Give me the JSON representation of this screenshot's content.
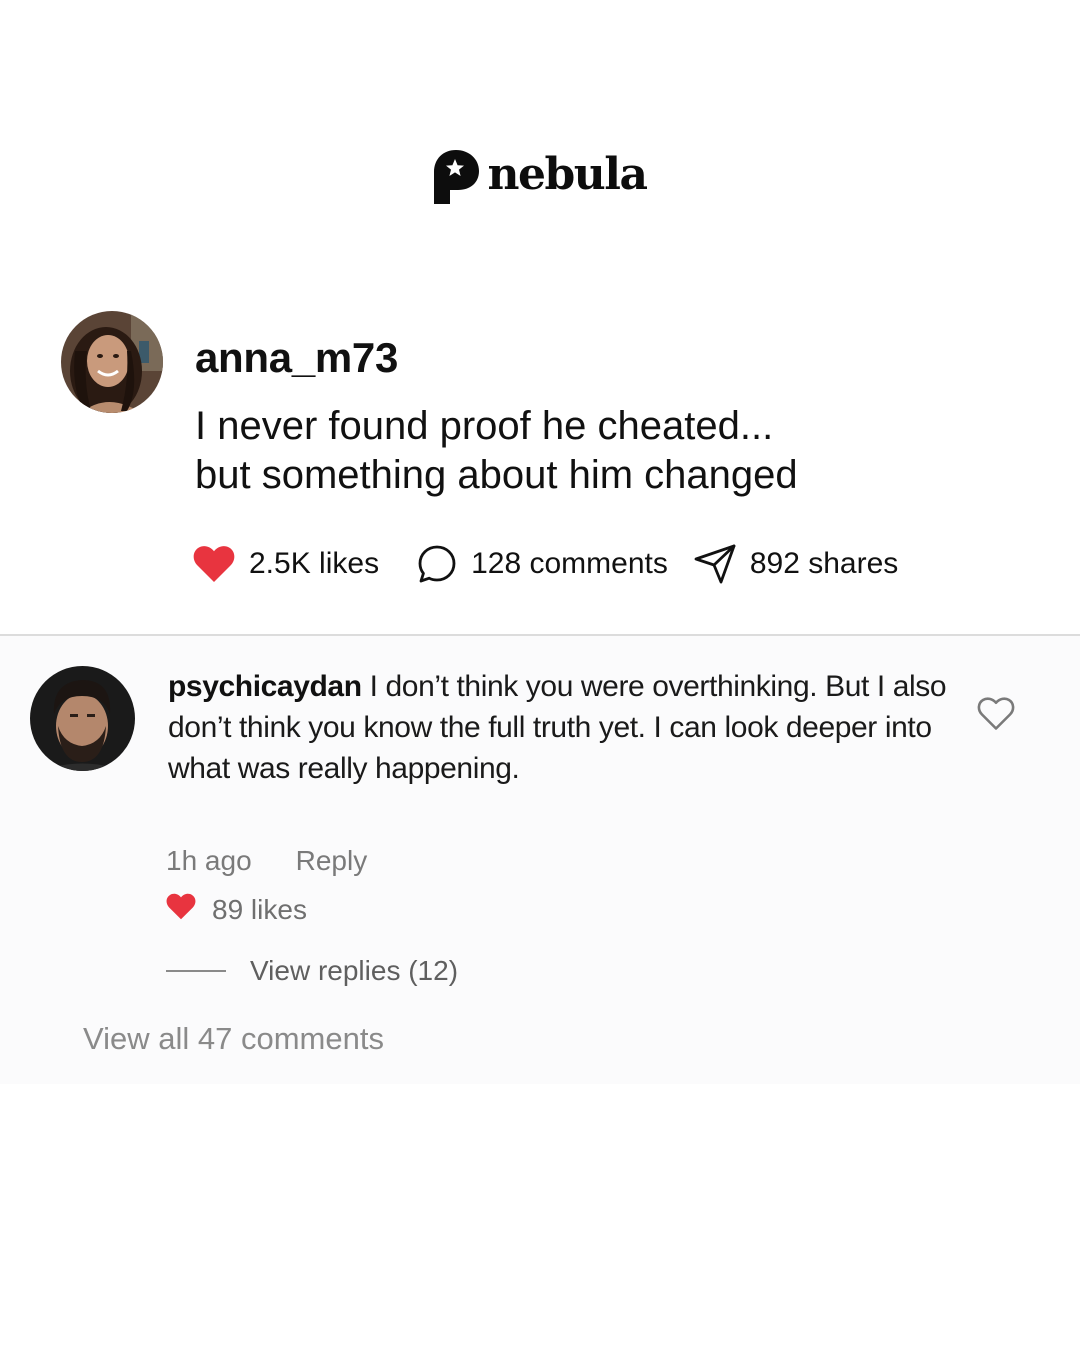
{
  "brand": {
    "name": "nebula",
    "logo_icon": "head-star-icon"
  },
  "post": {
    "username": "anna_m73",
    "text_lines": [
      "I never found proof he cheated...",
      "but something about him changed"
    ],
    "likes_label": "2.5K likes",
    "comments_label": "128 comments",
    "shares_label": "892 shares",
    "heart_color": "#e8343f"
  },
  "comment": {
    "username": "psychicaydan",
    "text": "I don’t think you were overthinking. But I also don’t think you know the full truth yet. I can look deeper into what was really happening.",
    "time": "1h ago",
    "reply_label": "Reply",
    "likes_label": "89 likes",
    "view_replies_label": "View replies (12)"
  },
  "view_all_label": "View all 47 comments"
}
